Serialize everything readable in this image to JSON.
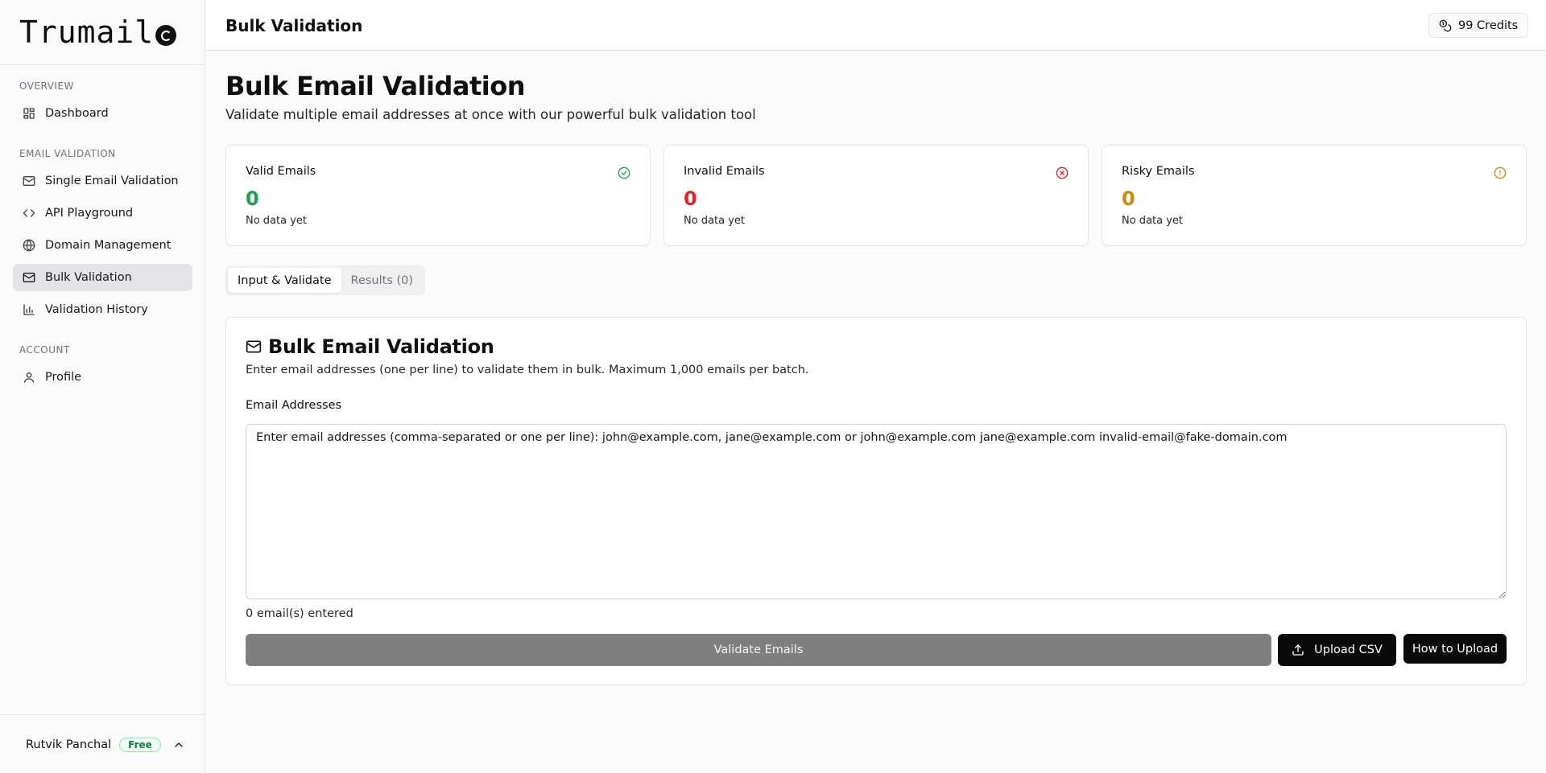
{
  "brand": {
    "name": "Trumail"
  },
  "sidebar": {
    "sections": [
      {
        "label": "OVERVIEW"
      },
      {
        "label": "EMAIL VALIDATION"
      },
      {
        "label": "ACCOUNT"
      }
    ],
    "items": [
      {
        "label": "Dashboard",
        "icon": "dashboard-grid-icon"
      },
      {
        "label": "Single Email Validation",
        "icon": "mail-icon"
      },
      {
        "label": "API Playground",
        "icon": "code-icon"
      },
      {
        "label": "Domain Management",
        "icon": "globe-icon"
      },
      {
        "label": "Bulk Validation",
        "icon": "mail-icon",
        "active": true
      },
      {
        "label": "Validation History",
        "icon": "bar-chart-icon"
      },
      {
        "label": "Profile",
        "icon": "user-icon"
      }
    ],
    "user": {
      "name": "Rutvik Panchal",
      "plan": "Free"
    }
  },
  "header": {
    "title": "Bulk Validation",
    "credits": "99 Credits"
  },
  "main": {
    "title": "Bulk Email Validation",
    "subtitle": "Validate multiple email addresses at once with our powerful bulk validation tool",
    "stats": [
      {
        "label": "Valid Emails",
        "value": "0",
        "sub": "No data yet",
        "color": "#16a34a",
        "icon": "check-circle-icon"
      },
      {
        "label": "Invalid Emails",
        "value": "0",
        "sub": "No data yet",
        "color": "#dc2626",
        "icon": "x-circle-icon"
      },
      {
        "label": "Risky Emails",
        "value": "0",
        "sub": "No data yet",
        "color": "#ca8a04",
        "icon": "alert-circle-icon"
      }
    ],
    "tabs": [
      {
        "label": "Input & Validate",
        "active": true
      },
      {
        "label": "Results (0)",
        "active": false
      }
    ],
    "panel": {
      "title": "Bulk Email Validation",
      "description": "Enter email addresses (one per line) to validate them in bulk. Maximum 1,000 emails per batch.",
      "field_label": "Email Addresses",
      "placeholder": "Enter email addresses (comma-separated or one per line): john@example.com, jane@example.com or john@example.com jane@example.com invalid-email@fake-domain.com",
      "value": "",
      "count_text": "0 email(s) entered",
      "validate_label": "Validate Emails",
      "upload_label": "Upload CSV",
      "howto_label": "How to Upload"
    }
  }
}
